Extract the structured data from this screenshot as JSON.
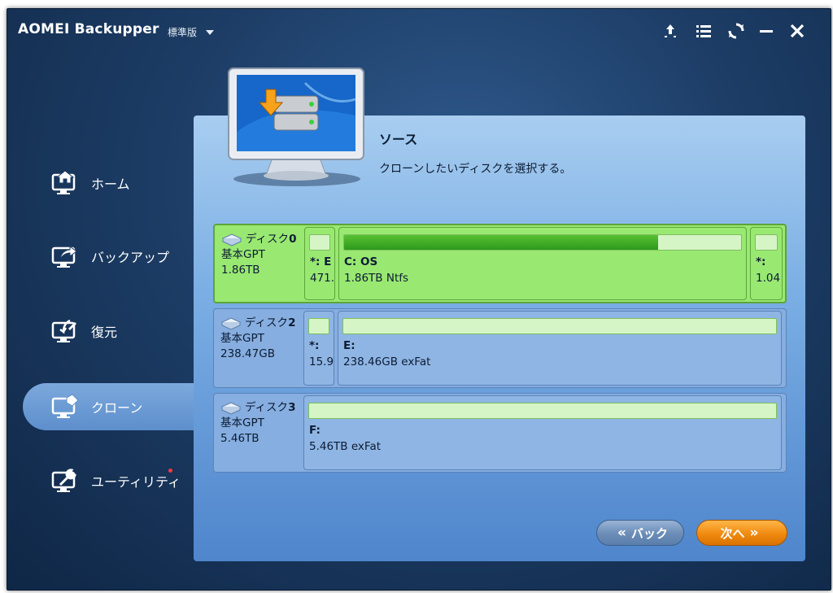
{
  "app": {
    "title": "AOMEI Backupper",
    "edition": "標準版"
  },
  "titlebar_buttons": [
    {
      "name": "upgrade-icon"
    },
    {
      "name": "menu-icon"
    },
    {
      "name": "refresh-icon"
    },
    {
      "name": "minimize-icon"
    },
    {
      "name": "close-icon"
    }
  ],
  "sidebar": {
    "items": [
      {
        "label": "ホーム",
        "icon": "home-icon"
      },
      {
        "label": "バックアップ",
        "icon": "backup-icon"
      },
      {
        "label": "復元",
        "icon": "restore-icon"
      },
      {
        "label": "クローン",
        "icon": "clone-icon",
        "active": true
      },
      {
        "label": "ユーティリティ",
        "icon": "utilities-icon",
        "notification_dot": true
      }
    ]
  },
  "step": {
    "title": "ソース",
    "description": "クローンしたいディスクを選択する。"
  },
  "disks": [
    {
      "name_prefix": "ディスク",
      "number": "0",
      "type": "基本GPT",
      "size": "1.86TB",
      "selected": true,
      "partitions": [
        {
          "label": "*: E",
          "size": "471.",
          "used_fraction": 0.0
        },
        {
          "label": "C: OS",
          "size": "1.86TB Ntfs",
          "used_fraction": 0.79
        },
        {
          "label": "*:",
          "size": "1.04",
          "used_fraction": 0.0
        }
      ]
    },
    {
      "name_prefix": "ディスク",
      "number": "2",
      "type": "基本GPT",
      "size": "238.47GB",
      "selected": false,
      "partitions": [
        {
          "label": "*:",
          "size": "15.9",
          "used_fraction": 0.0
        },
        {
          "label": "E:",
          "size": "238.46GB exFat",
          "used_fraction": 0.0
        }
      ]
    },
    {
      "name_prefix": "ディスク",
      "number": "3",
      "type": "基本GPT",
      "size": "5.46TB",
      "selected": false,
      "partitions": [
        {
          "label": "F:",
          "size": "5.46TB exFat",
          "used_fraction": 0.0
        }
      ]
    }
  ],
  "buttons": {
    "back": "バック",
    "next": "次へ"
  },
  "colors": {
    "window_bg": "#1d3d66",
    "panel_bg": "#7aaee4",
    "selected_disk": "#99e872",
    "next_button": "#f08a10",
    "notification_dot": "#ff3a3a"
  }
}
